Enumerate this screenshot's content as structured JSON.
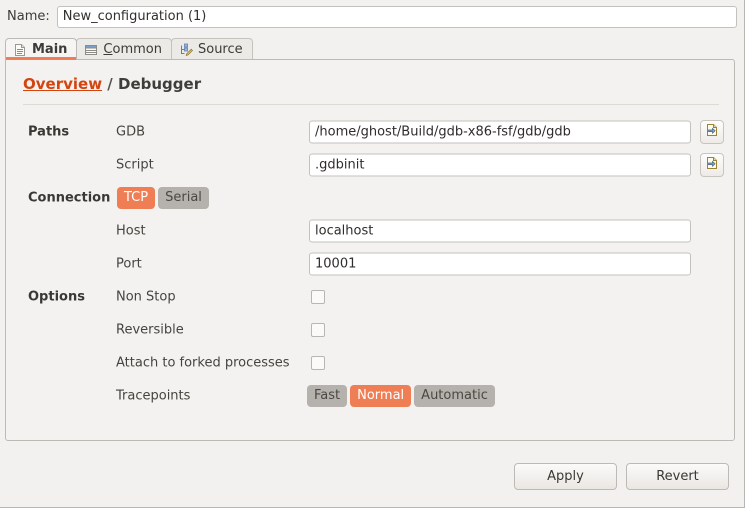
{
  "name_row": {
    "label": "Name:",
    "value": "New_configuration (1)",
    "placeholder": "Name"
  },
  "tabs": [
    {
      "label": "Main",
      "icon": "document-icon",
      "active": true,
      "mnemonic": "M"
    },
    {
      "label": "Common",
      "icon": "table-icon",
      "active": false,
      "mnemonic": "C"
    },
    {
      "label": "Source",
      "icon": "source-edit-icon",
      "active": false,
      "mnemonic": ""
    }
  ],
  "breadcrumb": {
    "link": "Overview",
    "separator": "/",
    "current": "Debugger"
  },
  "sections": {
    "paths": {
      "label": "Paths",
      "gdb": {
        "label": "GDB",
        "value": "/home/ghost/Build/gdb-x86-fsf/gdb/gdb",
        "placeholder": "",
        "browse_icon": "browse-file-icon"
      },
      "script": {
        "label": "Script",
        "value": ".gdbinit",
        "placeholder": "",
        "browse_icon": "browse-file-icon"
      }
    },
    "connection": {
      "label": "Connection",
      "modes": [
        {
          "label": "TCP",
          "selected": true
        },
        {
          "label": "Serial",
          "selected": false
        }
      ],
      "host": {
        "label": "Host",
        "value": "localhost",
        "placeholder": ""
      },
      "port": {
        "label": "Port",
        "value": "10001",
        "placeholder": ""
      }
    },
    "options": {
      "label": "Options",
      "checkboxes": [
        {
          "label": "Non Stop",
          "checked": false
        },
        {
          "label": "Reversible",
          "checked": false
        },
        {
          "label": "Attach to forked processes",
          "checked": false
        }
      ],
      "tracepoints": {
        "label": "Tracepoints",
        "modes": [
          {
            "label": "Fast",
            "selected": false
          },
          {
            "label": "Normal",
            "selected": true
          },
          {
            "label": "Automatic",
            "selected": false
          }
        ]
      }
    }
  },
  "footer": {
    "apply": "Apply",
    "revert": "Revert"
  },
  "colors": {
    "accent_orange": "#ef7e54",
    "link_orange": "#d4440f",
    "segment_gray": "#b5b2ad",
    "panel_bg": "#f4f2f0",
    "window_bg": "#f2f1f0"
  }
}
